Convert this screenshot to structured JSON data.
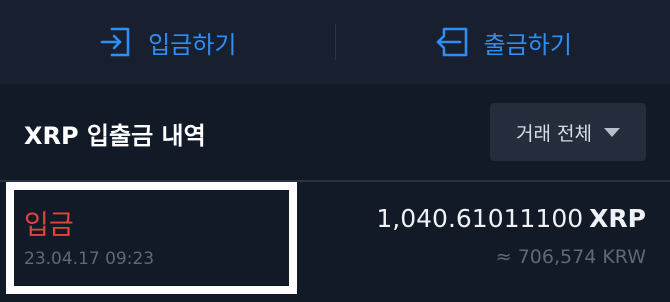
{
  "actions": {
    "deposit_label": "입금하기",
    "withdraw_label": "출금하기"
  },
  "history": {
    "title": "XRP 입출금 내역",
    "filter_label": "거래 전체"
  },
  "transactions": [
    {
      "type": "입금",
      "datetime": "23.04.17 09:23",
      "amount": "1,040.61011100",
      "unit": "XRP",
      "krw_value": "≈ 706,574 KRW"
    }
  ],
  "colors": {
    "accent": "#2f8ef5",
    "deposit": "#e0453b",
    "background": "#141b29",
    "highlight_box": "#ffffff"
  }
}
